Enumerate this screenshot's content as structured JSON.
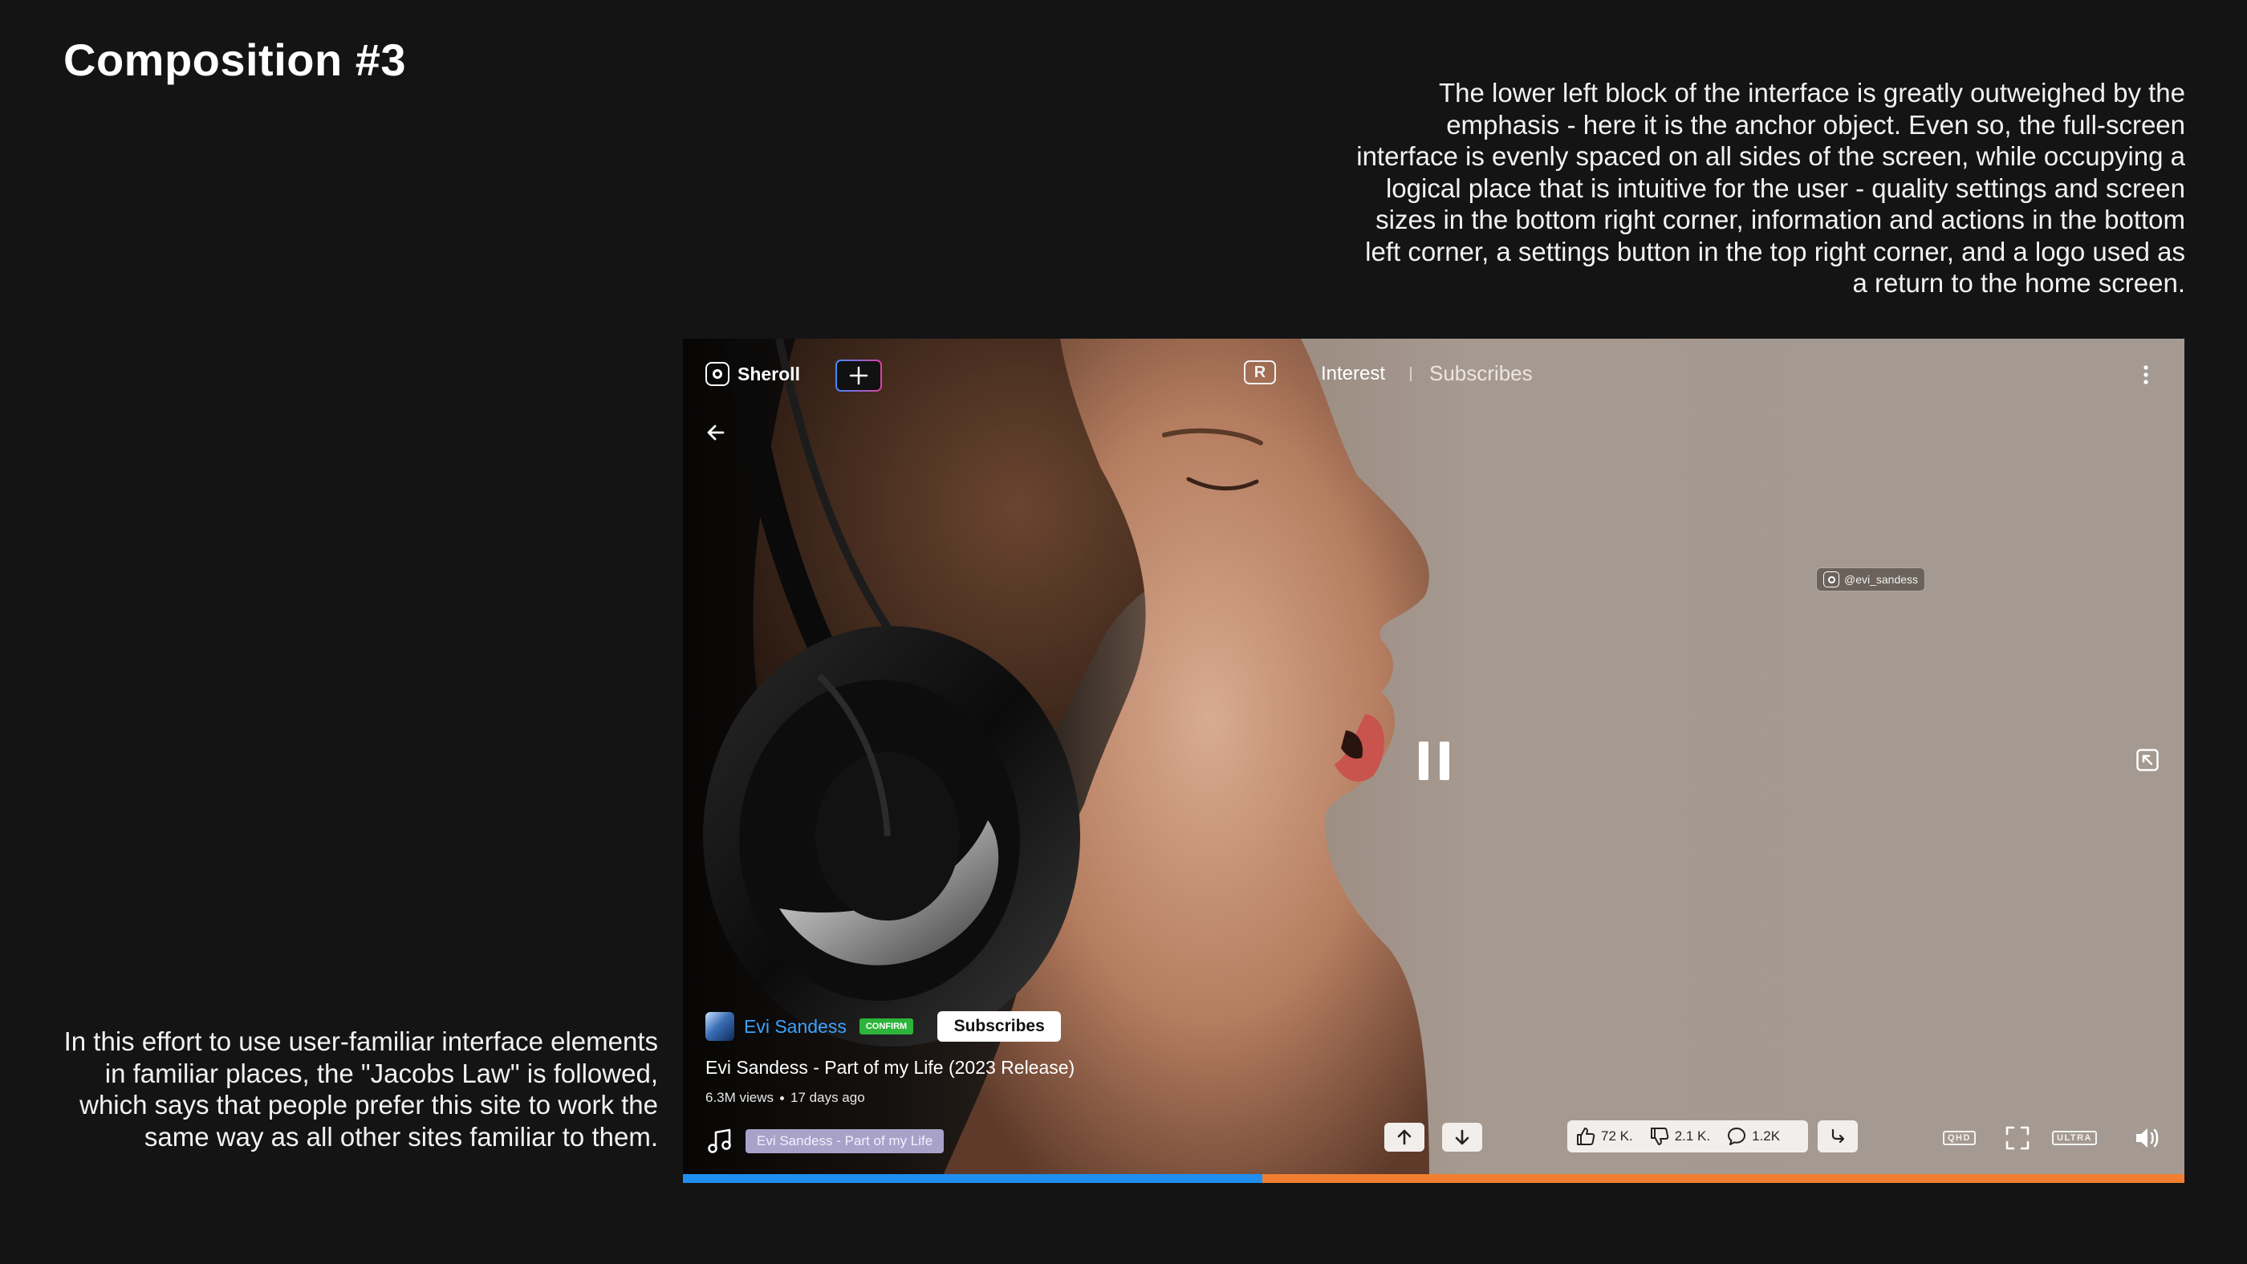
{
  "page": {
    "title": "Composition #3",
    "description_top": "The lower left block of the interface is greatly outweighed by the emphasis - here it is the anchor object. Even so, the full-screen interface is evenly spaced on all sides of the screen, while occupying a logical place that is intuitive for the user - quality settings and screen sizes in the bottom right corner, information and actions in the bottom left corner, a settings button in the top right corner, and a logo used as a return to the home screen.",
    "description_bottom": "In this effort to use user-familiar interface elements in familiar places, the \"Jacobs Law\" is followed, which says that people prefer this site to work the same way as all other sites familiar to them."
  },
  "player": {
    "logo_text": "Sheroll",
    "r_icon_letter": "R",
    "tabs": {
      "interest": "Interest",
      "subscribes": "Subscribes"
    },
    "watermark": "@evi_sandess",
    "channel": {
      "name": "Evi Sandess",
      "badge": "CONFIRM",
      "subscribe_label": "Subscribes"
    },
    "video": {
      "title": "Evi Sandess - Part of my Life (2023 Release)",
      "views": "6.3M views",
      "age": "17 days ago"
    },
    "music_chip": "Evi Sandess - Part of my Life",
    "stats": {
      "likes": "72 K.",
      "dislikes": "2.1 K.",
      "comments": "1.2K"
    },
    "quality_badges": {
      "qhd": "QHD",
      "ultra": "ULTRA"
    },
    "progress_fraction": 0.386,
    "icons": [
      "sheroll-logo-icon",
      "plus-icon",
      "r-logo-icon",
      "kebab-menu-icon",
      "back-arrow-icon",
      "pause-icon",
      "miniplayer-icon",
      "music-note-icon",
      "arrow-up-icon",
      "arrow-down-icon",
      "thumbs-up-icon",
      "thumbs-down-icon",
      "comment-icon",
      "share-icon",
      "fullscreen-icon",
      "volume-icon"
    ],
    "colors": {
      "progress_played": "#1e8ff0",
      "progress_remaining": "#f07f30",
      "channel_name": "#3da2ff",
      "confirm_badge": "#2cb53a",
      "music_chip": "#a9a2c8"
    }
  }
}
